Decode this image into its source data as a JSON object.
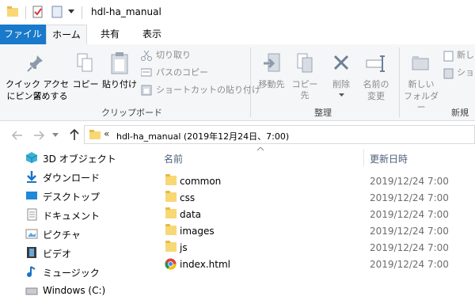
{
  "window": {
    "title": "hdl-ha_manual"
  },
  "tabs": {
    "file": "ファイル",
    "home": "ホーム",
    "share": "共有",
    "view": "表示"
  },
  "ribbon": {
    "pin_label_1": "クイック アクセス",
    "pin_label_2": "にピン留めする",
    "copy": "コピー",
    "paste": "貼り付け",
    "cut": "切り取り",
    "copy_path": "パスのコピー",
    "paste_shortcut": "ショートカットの貼り付け",
    "clipboard_group": "クリップボード",
    "move_to": "移動先",
    "copy_to": "コピー先",
    "delete": "削除",
    "rename_1": "名前の",
    "rename_2": "変更",
    "organize_group": "整理",
    "new_folder_1": "新しい",
    "new_folder_2": "フォルダー",
    "new_item": "新し",
    "easy_access": "ショー",
    "new_group": "新規"
  },
  "address": {
    "chevron": "«",
    "path": "hdl-ha_manual (2019年12月24日、7:00)"
  },
  "nav": [
    {
      "label": "3D オブジェクト"
    },
    {
      "label": "ダウンロード"
    },
    {
      "label": "デスクトップ"
    },
    {
      "label": "ドキュメント"
    },
    {
      "label": "ピクチャ"
    },
    {
      "label": "ビデオ"
    },
    {
      "label": "ミュージック"
    },
    {
      "label": "Windows (C:)"
    }
  ],
  "columns": {
    "name": "名前",
    "modified": "更新日時"
  },
  "files": [
    {
      "name": "common",
      "date": "2019/12/24 7:00"
    },
    {
      "name": "css",
      "date": "2019/12/24 7:00"
    },
    {
      "name": "data",
      "date": "2019/12/24 7:00"
    },
    {
      "name": "images",
      "date": "2019/12/24 7:00"
    },
    {
      "name": "js",
      "date": "2019/12/24 7:00"
    },
    {
      "name": "index.html",
      "date": "2019/12/24 7:00"
    }
  ],
  "colors": {
    "file_tab": "#1979ca",
    "folder": "#f8d775",
    "ribbon_bg": "#f5f6f7"
  }
}
